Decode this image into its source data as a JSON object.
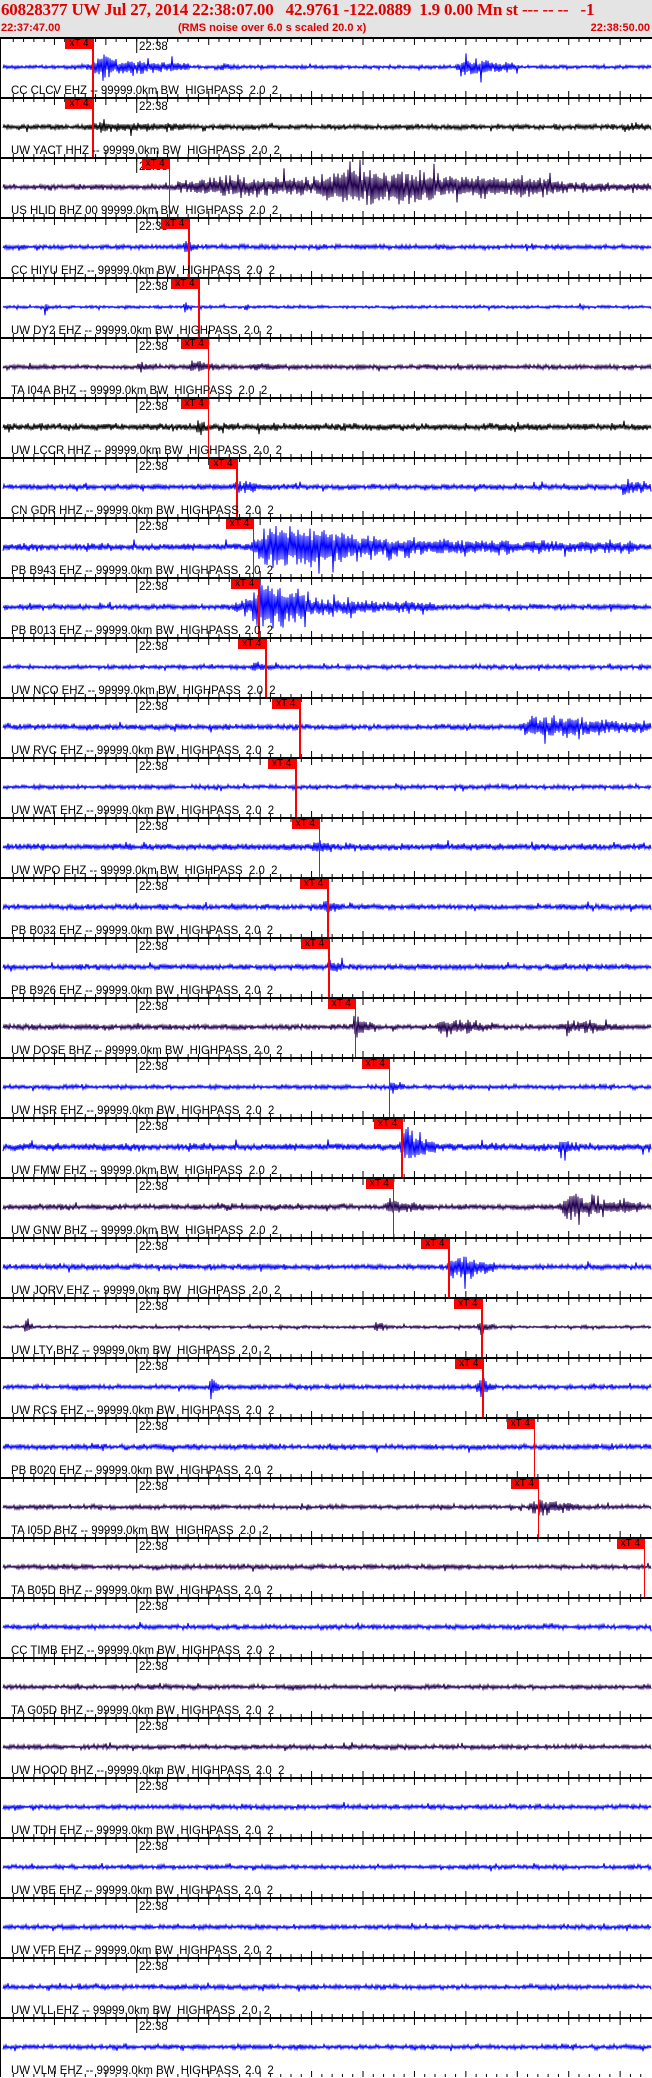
{
  "header": {
    "title": "60828377 UW Jul 27, 2014 22:38:07.00   42.9761 -122.0889  1.9 0.00 Mn st --- -- --   -1",
    "start_time": "22:37:47.00",
    "note": "(RMS noise over 6.0 s scaled 20.0 x)",
    "end_time": "22:38:50.00"
  },
  "chart_data": {
    "type": "line",
    "title": "Seismogram record section",
    "x_range_s": [
      0,
      63
    ],
    "x_start": "22:37:47.00",
    "minute_tick_label": "22:38",
    "minute_tick_s": 13,
    "pick_label": "xT 4",
    "colors": {
      "blue": "#0000ff",
      "navy": "#220050",
      "black": "#000000",
      "pick": "#ff0000"
    },
    "traces": [
      {
        "label": "CC CLCV EHZ -- 99999.0km BW  HIGHPASS  2.0  2",
        "color": "blue",
        "pick_s": 8.7,
        "noise": 1,
        "events": [
          [
            8,
            18,
            9
          ],
          [
            44,
            50,
            9
          ],
          [
            21,
            23,
            3
          ]
        ]
      },
      {
        "label": "UW YACT HHZ -- 99999.0km BW  HIGHPASS  2.0  2",
        "color": "black",
        "pick_s": 8.7,
        "noise": 1.5,
        "events": [
          [
            8,
            18,
            2.5
          ],
          [
            60,
            63,
            2
          ]
        ]
      },
      {
        "label": "US HLID BHZ 00 99999.0km BW  HIGHPASS  2.0  2",
        "color": "navy",
        "pick_s": 16.1,
        "noise": 1.5,
        "events": [
          [
            15,
            63,
            7
          ],
          [
            30,
            55,
            12
          ]
        ]
      },
      {
        "label": "CC HIYU EHZ -- 99999.0km BW  HIGHPASS  2.0  2",
        "color": "blue",
        "pick_s": 18.0,
        "noise": 1.3,
        "events": [
          [
            17.5,
            19,
            5
          ]
        ]
      },
      {
        "label": "UW DY2 EHZ -- 99999.0km BW  HIGHPASS  2.0  2",
        "color": "blue",
        "pick_s": 19.0,
        "noise": 0.8,
        "events": [
          [
            4,
            4.5,
            6
          ],
          [
            17.5,
            18.3,
            5
          ],
          [
            23.5,
            24,
            6
          ],
          [
            56,
            56.5,
            4
          ]
        ]
      },
      {
        "label": "TA I04A BHZ -- 99999.0km BW  HIGHPASS  2.0  2",
        "color": "navy",
        "pick_s": 19.9,
        "noise": 1.3,
        "events": [
          [
            18,
            21,
            5
          ],
          [
            13,
            15,
            2.5
          ],
          [
            24,
            27,
            3
          ]
        ]
      },
      {
        "label": "UW LCCR HHZ -- 99999.0km BW  HIGHPASS  2.0  2",
        "color": "black",
        "pick_s": 19.9,
        "noise": 2,
        "events": [
          [
            18.8,
            19.6,
            9
          ]
        ]
      },
      {
        "label": "CN GDR HHZ -- 99999.0km BW  HIGHPASS  2.0  2",
        "color": "blue",
        "pick_s": 22.7,
        "noise": 1.5,
        "events": [
          [
            22,
            26,
            4
          ],
          [
            60,
            63,
            6
          ]
        ]
      },
      {
        "label": "PB B943 EHZ -- 99999.0km BW  HIGHPASS  2.0  2",
        "color": "blue",
        "pick_s": 24.3,
        "noise": 2,
        "events": [
          [
            23,
            62,
            8
          ],
          [
            24,
            34,
            14
          ]
        ]
      },
      {
        "label": "PB B013 EHZ -- 99999.0km BW  HIGHPASS  2.0  2",
        "color": "blue",
        "pick_s": 24.8,
        "noise": 1.5,
        "events": [
          [
            22,
            42,
            10
          ],
          [
            24,
            30,
            14
          ]
        ]
      },
      {
        "label": "UW NCO EHZ -- 99999.0km BW  HIGHPASS  2.0  2",
        "color": "blue",
        "pick_s": 25.5,
        "noise": 1.2,
        "events": [
          [
            24,
            27,
            3
          ]
        ]
      },
      {
        "label": "UW RVC EHZ -- 99999.0km BW  HIGHPASS  2.0  2",
        "color": "blue",
        "pick_s": 28.8,
        "noise": 1.5,
        "events": [
          [
            50,
            63,
            10
          ]
        ]
      },
      {
        "label": "UW WAT EHZ -- 99999.0km BW  HIGHPASS  2.0  2",
        "color": "blue",
        "pick_s": 28.4,
        "noise": 1.2,
        "events": []
      },
      {
        "label": "UW WPO EHZ -- 99999.0km BW  HIGHPASS  2.0  2",
        "color": "blue",
        "pick_s": 30.7,
        "noise": 1.8,
        "events": [
          [
            30,
            32,
            5
          ]
        ]
      },
      {
        "label": "PB B032 EHZ -- 99999.0km BW  HIGHPASS  2.0  2",
        "color": "blue",
        "pick_s": 31.5,
        "noise": 1.5,
        "events": [
          [
            31,
            33,
            7
          ]
        ]
      },
      {
        "label": "PB B926 EHZ -- 99999.0km BW  HIGHPASS  2.0  2",
        "color": "blue",
        "pick_s": 31.6,
        "noise": 1.5,
        "events": [
          [
            31.5,
            33,
            8
          ]
        ]
      },
      {
        "label": "UW DOSE BHZ -- 99999.0km BW  HIGHPASS  2.0  2",
        "color": "navy",
        "pick_s": 34.2,
        "noise": 1.5,
        "events": [
          [
            34,
            36,
            9
          ],
          [
            42,
            48,
            6
          ],
          [
            54,
            60,
            5
          ]
        ]
      },
      {
        "label": "UW HSR EHZ -- 99999.0km BW  HIGHPASS  2.0  2",
        "color": "blue",
        "pick_s": 37.5,
        "noise": 1.2,
        "events": [
          [
            37.5,
            39,
            7
          ]
        ]
      },
      {
        "label": "UW FMW EHZ -- 99999.0km BW  HIGHPASS  2.0  2",
        "color": "blue",
        "pick_s": 38.7,
        "noise": 2,
        "events": [
          [
            38.5,
            42,
            14
          ],
          [
            54,
            56,
            8
          ]
        ]
      },
      {
        "label": "UW GNW BHZ -- 99999.0km BW  HIGHPASS  2.0  2",
        "color": "navy",
        "pick_s": 37.9,
        "noise": 1.5,
        "events": [
          [
            37,
            41,
            5
          ],
          [
            54,
            62,
            12
          ]
        ]
      },
      {
        "label": "UW JORV EHZ -- 99999.0km BW  HIGHPASS  2.0  2",
        "color": "blue",
        "pick_s": 43.3,
        "noise": 1.5,
        "events": [
          [
            43,
            48,
            12
          ]
        ]
      },
      {
        "label": "UW LTY BHZ -- 99999.0km BW  HIGHPASS  2.0  2",
        "color": "navy",
        "pick_s": 46.5,
        "noise": 0.8,
        "events": [
          [
            2,
            3,
            5
          ],
          [
            46,
            48,
            6
          ],
          [
            36,
            37.5,
            4
          ]
        ]
      },
      {
        "label": "UW RCS EHZ -- 99999.0km BW  HIGHPASS  2.0  2",
        "color": "blue",
        "pick_s": 46.6,
        "noise": 1.3,
        "events": [
          [
            46,
            48,
            7
          ],
          [
            20,
            21,
            9
          ]
        ]
      },
      {
        "label": "PB B020 EHZ -- 99999.0km BW  HIGHPASS  2.0  2",
        "color": "blue",
        "pick_s": 51.6,
        "noise": 1.5,
        "events": []
      },
      {
        "label": "TA I05D BHZ -- 99999.0km BW  HIGHPASS  2.0  2",
        "color": "navy",
        "pick_s": 52.0,
        "noise": 1.2,
        "events": [
          [
            51,
            56,
            7
          ]
        ]
      },
      {
        "label": "TA B05D BHZ -- 99999.0km BW  HIGHPASS  2.0  2",
        "color": "navy",
        "pick_s": 62.3,
        "noise": 1.3,
        "events": []
      },
      {
        "label": "CC TIMB EHZ -- 99999.0km BW  HIGHPASS  2.0  2",
        "color": "blue",
        "pick_s": null,
        "noise": 1.3,
        "events": []
      },
      {
        "label": "TA G05D BHZ -- 99999.0km BW  HIGHPASS  2.0  2",
        "color": "navy",
        "pick_s": null,
        "noise": 1.3,
        "events": []
      },
      {
        "label": "UW HOOD BHZ -- 99999.0km BW  HIGHPASS  2.0  2",
        "color": "navy",
        "pick_s": null,
        "noise": 1.3,
        "events": []
      },
      {
        "label": "UW TDH EHZ -- 99999.0km BW  HIGHPASS  2.0  2",
        "color": "blue",
        "pick_s": null,
        "noise": 1.3,
        "events": []
      },
      {
        "label": "UW VBE EHZ -- 99999.0km BW  HIGHPASS  2.0  2",
        "color": "blue",
        "pick_s": null,
        "noise": 1.2,
        "events": []
      },
      {
        "label": "UW VFP EHZ -- 99999.0km BW  HIGHPASS  2.0  2",
        "color": "blue",
        "pick_s": null,
        "noise": 1.3,
        "events": []
      },
      {
        "label": "UW VLL EHZ -- 99999.0km BW  HIGHPASS  2.0  2",
        "color": "blue",
        "pick_s": null,
        "noise": 1.3,
        "events": []
      },
      {
        "label": "UW VLM EHZ -- 99999.0km BW  HIGHPASS  2.0  2",
        "color": "blue",
        "pick_s": null,
        "noise": 1.3,
        "events": []
      }
    ]
  }
}
